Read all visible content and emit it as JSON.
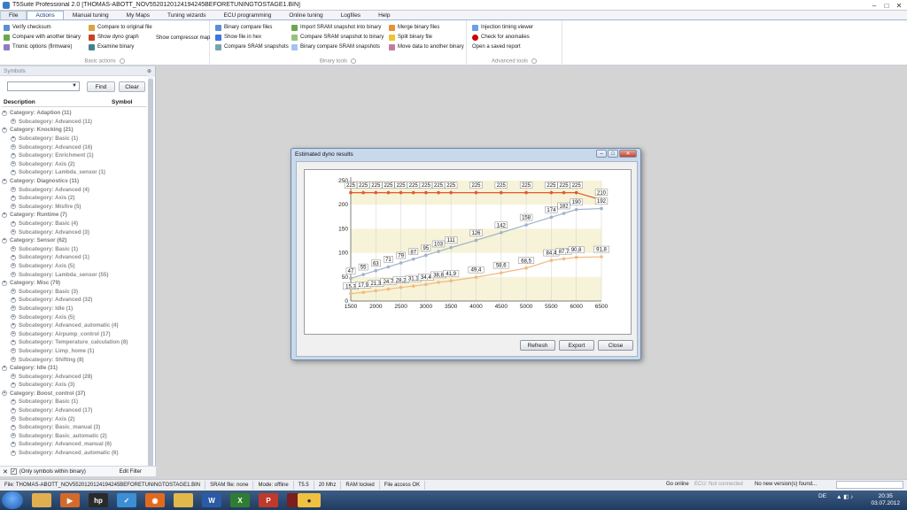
{
  "window": {
    "title": "T5Suite Professional 2.0 [THOMAS-ABOTT_NOV5520120124194245BEFORETUNINGTOSTAGE1.BIN]",
    "controls": [
      "–",
      "□",
      "✕"
    ]
  },
  "tabs": [
    "File",
    "Actions",
    "Manual tuning",
    "My Maps",
    "Tuning wizards",
    "ECU programming",
    "Online tuning",
    "Logfiles",
    "Help"
  ],
  "active_tab": "Actions",
  "ribbon": {
    "basic": {
      "label": "Basic actions",
      "col1": [
        "Verify checksum",
        "Compare with another binary",
        "Trionic options (firmware)"
      ],
      "col2": [
        "Compare to original file",
        "Show dyno graph",
        "Examine binary"
      ],
      "col3": [
        "Show compressor map"
      ]
    },
    "binary": {
      "label": "Binary tools",
      "col1": [
        "Binary compare files",
        "Show file in hex",
        "Compare SRAM snapshots"
      ],
      "col2": [
        "Import SRAM snapshot into binary",
        "Compare SRAM snapshot to binary",
        "Binary compare SRAM snapshots"
      ],
      "col3": [
        "Merge binary files",
        "Split binary file",
        "Move data to another binary"
      ]
    },
    "advanced": {
      "label": "Advanced tools",
      "col1": [
        "Injection timing viewer",
        "Check for anomalies",
        "Open a saved report"
      ]
    }
  },
  "symbols": {
    "panel_title": "Symbols",
    "find_label": "Find",
    "clear_label": "Clear",
    "col_description": "Description",
    "col_symbol": "Symbol",
    "tree": [
      {
        "t": "cat",
        "s": "+",
        "label": "Category: Adaption (11)"
      },
      {
        "t": "sub",
        "s": "+",
        "label": "Subcategory: Advanced (11)"
      },
      {
        "t": "cat",
        "s": "+",
        "label": "Category: Knocking (21)"
      },
      {
        "t": "sub",
        "s": "+",
        "label": "Subcategory: Basic (1)"
      },
      {
        "t": "sub",
        "s": "+",
        "label": "Subcategory: Advanced (16)"
      },
      {
        "t": "sub",
        "s": "+",
        "label": "Subcategory: Enrichment (1)"
      },
      {
        "t": "sub",
        "s": "+",
        "label": "Subcategory: Axis (2)"
      },
      {
        "t": "sub",
        "s": "+",
        "label": "Subcategory: Lambda_sensor (1)"
      },
      {
        "t": "cat",
        "s": "+",
        "label": "Category: Diagnostics (11)"
      },
      {
        "t": "sub",
        "s": "+",
        "label": "Subcategory: Advanced (4)"
      },
      {
        "t": "sub",
        "s": "+",
        "label": "Subcategory: Axis (2)"
      },
      {
        "t": "sub",
        "s": "+",
        "label": "Subcategory: Misfire (5)"
      },
      {
        "t": "cat",
        "s": "+",
        "label": "Category: Runtime (7)"
      },
      {
        "t": "sub",
        "s": "+",
        "label": "Subcategory: Basic (4)"
      },
      {
        "t": "sub",
        "s": "+",
        "label": "Subcategory: Advanced (3)"
      },
      {
        "t": "cat",
        "s": "+",
        "label": "Category: Sensor (62)"
      },
      {
        "t": "sub",
        "s": "+",
        "label": "Subcategory: Basic (1)"
      },
      {
        "t": "sub",
        "s": "+",
        "label": "Subcategory: Advanced (1)"
      },
      {
        "t": "sub",
        "s": "+",
        "label": "Subcategory: Axis (5)"
      },
      {
        "t": "sub",
        "s": "+",
        "label": "Subcategory: Lambda_sensor (55)"
      },
      {
        "t": "cat",
        "s": "+",
        "label": "Category: Misc (79)"
      },
      {
        "t": "sub",
        "s": "+",
        "label": "Subcategory: Basic (3)"
      },
      {
        "t": "sub",
        "s": "+",
        "label": "Subcategory: Advanced (32)"
      },
      {
        "t": "sub",
        "s": "+",
        "label": "Subcategory: Idle (1)"
      },
      {
        "t": "sub",
        "s": "+",
        "label": "Subcategory: Axis (5)"
      },
      {
        "t": "sub",
        "s": "+",
        "label": "Subcategory: Advanced_automatic (4)"
      },
      {
        "t": "sub",
        "s": "+",
        "label": "Subcategory: Airpump_control (17)"
      },
      {
        "t": "sub",
        "s": "+",
        "label": "Subcategory: Temperature_calculation (8)"
      },
      {
        "t": "sub",
        "s": "+",
        "label": "Subcategory: Limp_home (1)"
      },
      {
        "t": "sub",
        "s": "+",
        "label": "Subcategory: Shifting (8)"
      },
      {
        "t": "cat",
        "s": "+",
        "label": "Category: Idle (31)"
      },
      {
        "t": "sub",
        "s": "+",
        "label": "Subcategory: Advanced (28)"
      },
      {
        "t": "sub",
        "s": "+",
        "label": "Subcategory: Axis (3)"
      },
      {
        "t": "cat",
        "s": "+",
        "label": "Category: Boost_control (37)"
      },
      {
        "t": "sub",
        "s": "+",
        "label": "Subcategory: Basic (1)"
      },
      {
        "t": "sub",
        "s": "+",
        "label": "Subcategory: Advanced (17)"
      },
      {
        "t": "sub",
        "s": "+",
        "label": "Subcategory: Axis (2)"
      },
      {
        "t": "sub",
        "s": "+",
        "label": "Subcategory: Basic_manual (3)"
      },
      {
        "t": "sub",
        "s": "+",
        "label": "Subcategory: Basic_automatic (2)"
      },
      {
        "t": "sub",
        "s": "+",
        "label": "Subcategory: Advanced_manual (6)"
      },
      {
        "t": "sub",
        "s": "+",
        "label": "Subcategory: Advanced_automatic (6)"
      }
    ],
    "footer_checkbox": "(Only symbols within binary)",
    "footer_filter": "Edit Filter"
  },
  "dialog": {
    "title": "Estimated dyno results",
    "refresh_label": "Refresh",
    "export_label": "Export",
    "close_label": "Close"
  },
  "chart_data": {
    "type": "line",
    "x": [
      1500,
      1750,
      2000,
      2250,
      2500,
      2750,
      3000,
      3250,
      3500,
      4000,
      4500,
      5000,
      5500,
      5750,
      6000,
      6500
    ],
    "xlim": [
      1500,
      6500
    ],
    "ylim": [
      0,
      250
    ],
    "xticks": [
      1500,
      2000,
      2500,
      3000,
      3500,
      4000,
      4500,
      5000,
      5500,
      6000,
      6500
    ],
    "yticks": [
      0,
      50,
      100,
      150,
      200,
      250
    ],
    "grid": "vertical",
    "bands": [
      [
        0,
        50
      ],
      [
        100,
        150
      ],
      [
        200,
        250
      ]
    ],
    "series": [
      {
        "color": "#e05a2b",
        "values": [
          225,
          225,
          225,
          225,
          225,
          225,
          225,
          225,
          225,
          225,
          225,
          225,
          225,
          225,
          225,
          210
        ],
        "labels": [
          "225",
          "225",
          "225",
          "225",
          "225",
          "225",
          "225",
          "225",
          "225",
          "225",
          "225",
          "225",
          "225",
          "225",
          "225",
          "210"
        ]
      },
      {
        "color": "#9fb3cc",
        "values": [
          47,
          55,
          63,
          71,
          79,
          87,
          95,
          103,
          111,
          126,
          142,
          158,
          174,
          182,
          190,
          192
        ],
        "labels": [
          "47",
          "55",
          "63",
          "71",
          "79",
          "87",
          "95",
          "103",
          "111",
          "126",
          "142",
          "158",
          "174",
          "182",
          "190",
          "192"
        ]
      },
      {
        "color": "#f2b97e",
        "values": [
          15.3,
          17.9,
          21.3,
          24.7,
          28.2,
          31.1,
          34.4,
          38.8,
          41.9,
          49.4,
          58.6,
          68.5,
          84.4,
          87.7,
          90.8,
          91.8
        ],
        "labels": [
          "15,3",
          "17,9",
          "21,3",
          "24,7",
          "28,2",
          "31,1",
          "34,4",
          "38,8",
          "41,9",
          "49,4",
          "58,6",
          "68,5",
          "84,4",
          "87,7",
          "90,8",
          "91,8"
        ]
      }
    ]
  },
  "statusbar": {
    "file": "File: THOMAS-ABOTT_NOV5520120124194245BEFORETUNINGTOSTAGE1.BIN",
    "sram": "SRAM file: none",
    "mode": "Mode: offline",
    "ecu": "T5.5",
    "mhz": "20 Mhz",
    "ram": "RAM locked",
    "access": "File access OK",
    "go_online": "Go online",
    "ecu_conn": "ECU: Not connected",
    "version": "No new version(s) found..."
  },
  "taskbar": {
    "lang": "DE",
    "time": "20:35",
    "date": "03.07.2012"
  }
}
